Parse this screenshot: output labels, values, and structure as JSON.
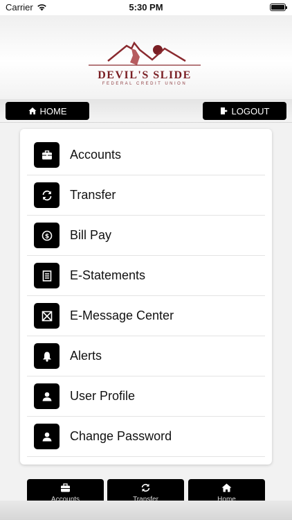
{
  "status_bar": {
    "carrier": "Carrier",
    "time": "5:30 PM"
  },
  "header": {
    "logo_name": "DEVIL'S SLIDE",
    "logo_subtitle": "FEDERAL CREDIT UNION"
  },
  "nav": {
    "home_label": "HOME",
    "logout_label": "LOGOUT"
  },
  "menu": {
    "items": [
      {
        "label": "Accounts",
        "icon": "briefcase-icon"
      },
      {
        "label": "Transfer",
        "icon": "refresh-icon"
      },
      {
        "label": "Bill Pay",
        "icon": "dollar-coin-icon"
      },
      {
        "label": "E-Statements",
        "icon": "document-icon"
      },
      {
        "label": "E-Message Center",
        "icon": "envelope-icon"
      },
      {
        "label": "Alerts",
        "icon": "bell-icon"
      },
      {
        "label": "User Profile",
        "icon": "user-icon"
      },
      {
        "label": "Change Password",
        "icon": "user-icon"
      }
    ]
  },
  "bottom_tabs": [
    {
      "label": "Accounts",
      "icon": "briefcase-icon"
    },
    {
      "label": "Transfer",
      "icon": "refresh-icon"
    },
    {
      "label": "Home",
      "icon": "home-icon"
    }
  ],
  "colors": {
    "brand": "#7a1f24",
    "button": "#000000"
  }
}
